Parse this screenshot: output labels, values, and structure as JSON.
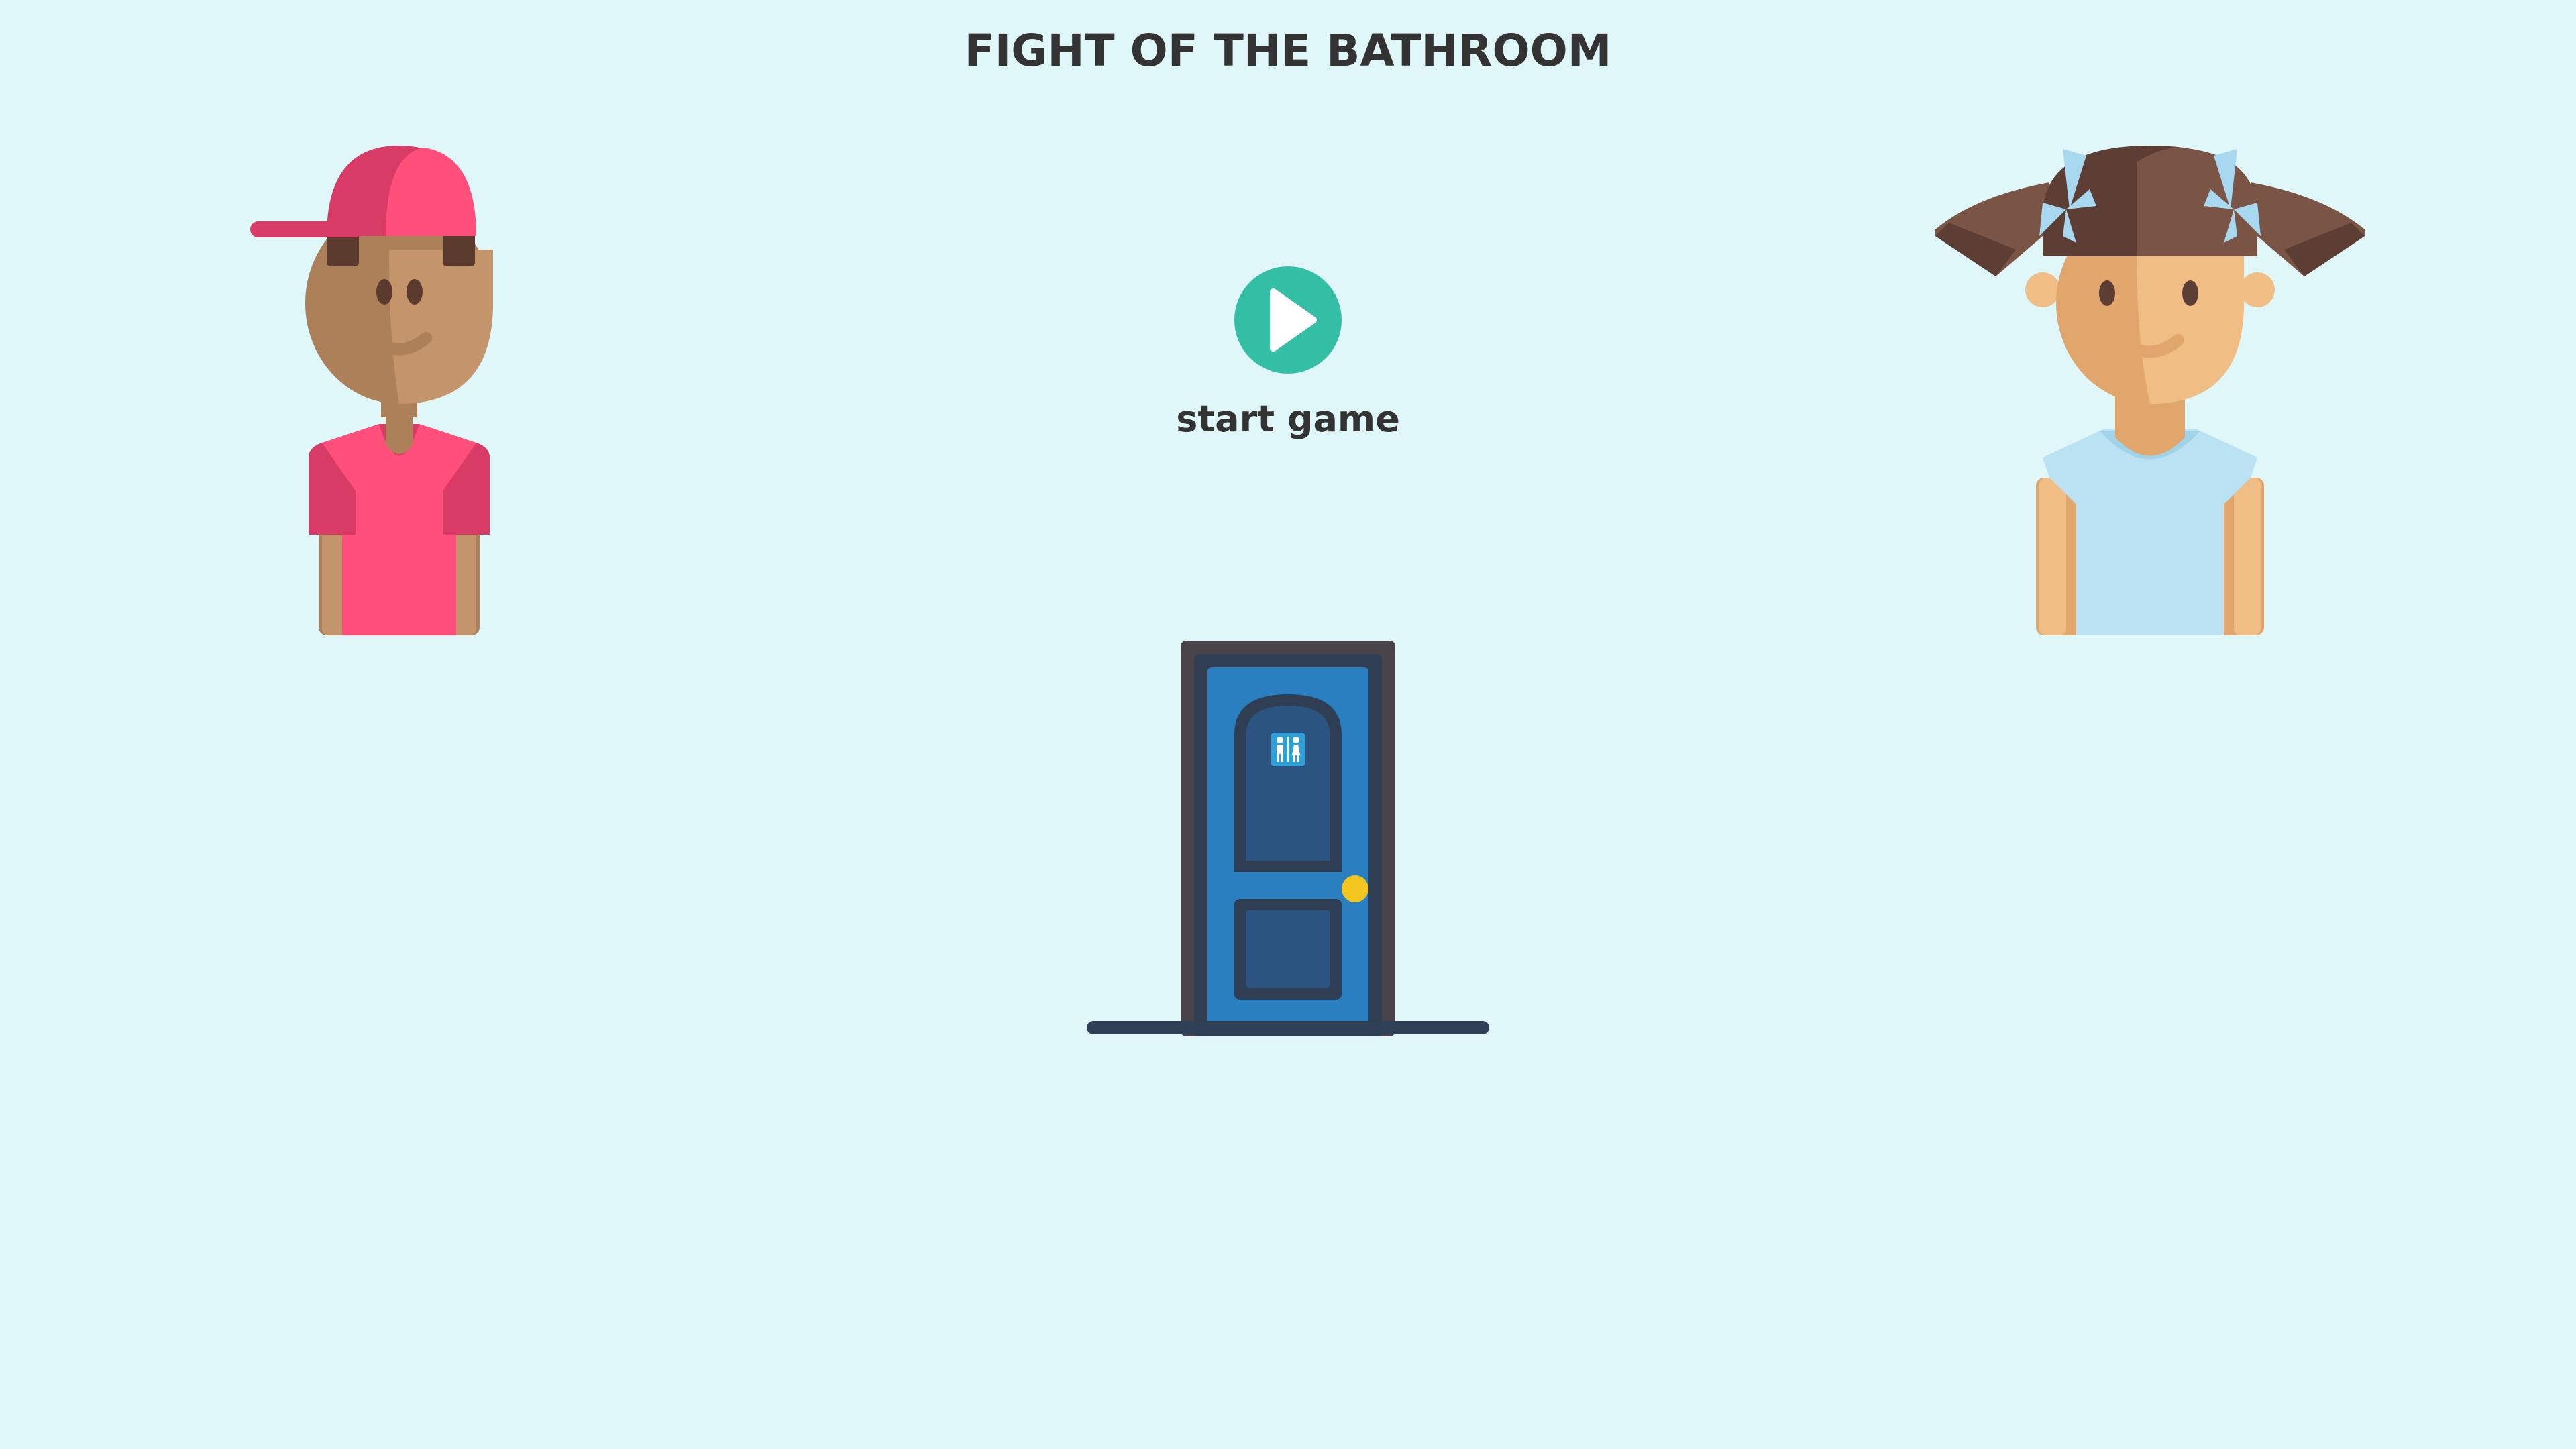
{
  "game": {
    "title": "FIGHT OF THE BATHROOM",
    "start_label": "start game"
  },
  "colors": {
    "background": "#e0f7f9",
    "text": "#333333",
    "play_button": "#33bfa6",
    "door_frame": "#4a4348",
    "door_inner_frame": "#2f3e52",
    "door_body": "#2a7fc0",
    "door_panel": "#2b5580",
    "door_knob": "#f2c61f",
    "floor_line": "#2e4156",
    "boy_shirt": "#ff4f7a",
    "boy_cap": "#ff4f7a",
    "boy_cap_shade": "#d83b66",
    "boy_skin": "#c4956a",
    "boy_skin_shade": "#ac8059",
    "boy_hair": "#5b3a2e",
    "girl_shirt": "#bbe2f2",
    "girl_shirt_collar": "#9ed3ea",
    "girl_skin": "#f0be85",
    "girl_skin_shade": "#e1a66b",
    "girl_hair": "#7a5546",
    "girl_hair_shade": "#5c3e34",
    "girl_bow": "#a7d8f0"
  },
  "icons": {
    "play": "play-icon",
    "restroom": "restroom-icon"
  }
}
